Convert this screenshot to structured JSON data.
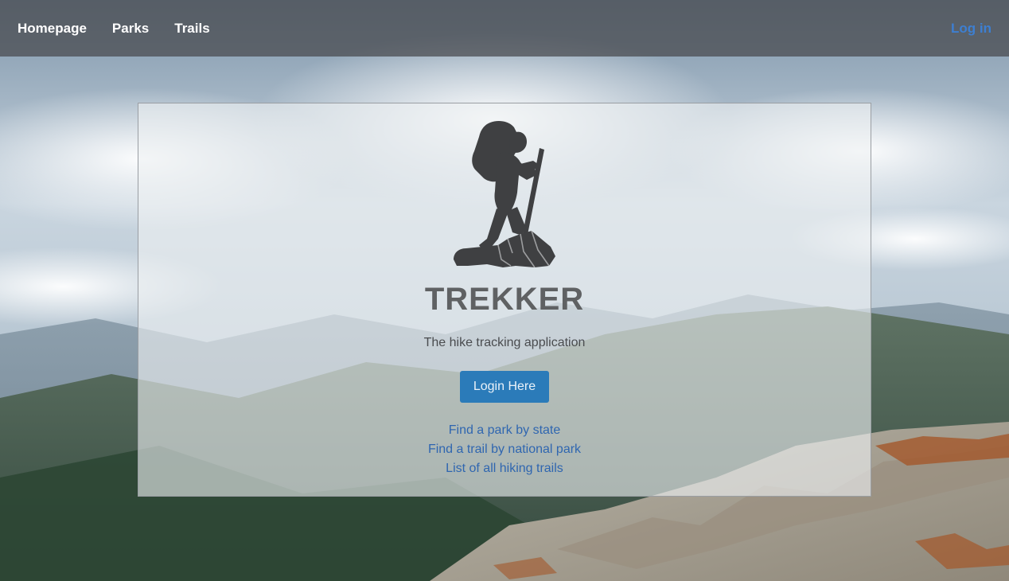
{
  "nav": {
    "links": [
      "Homepage",
      "Parks",
      "Trails"
    ],
    "login_label": "Log in"
  },
  "hero": {
    "logo_icon": "hiker-icon",
    "title": "TREKKER",
    "subtitle": "The hike tracking application",
    "login_button": "Login Here",
    "links": [
      "Find a park by state",
      "Find a trail by national park",
      "List of all hiking trails"
    ]
  },
  "colors": {
    "accent": "#2b7bb9",
    "link": "#2f66b0",
    "nav_login": "#3d7fd1"
  }
}
